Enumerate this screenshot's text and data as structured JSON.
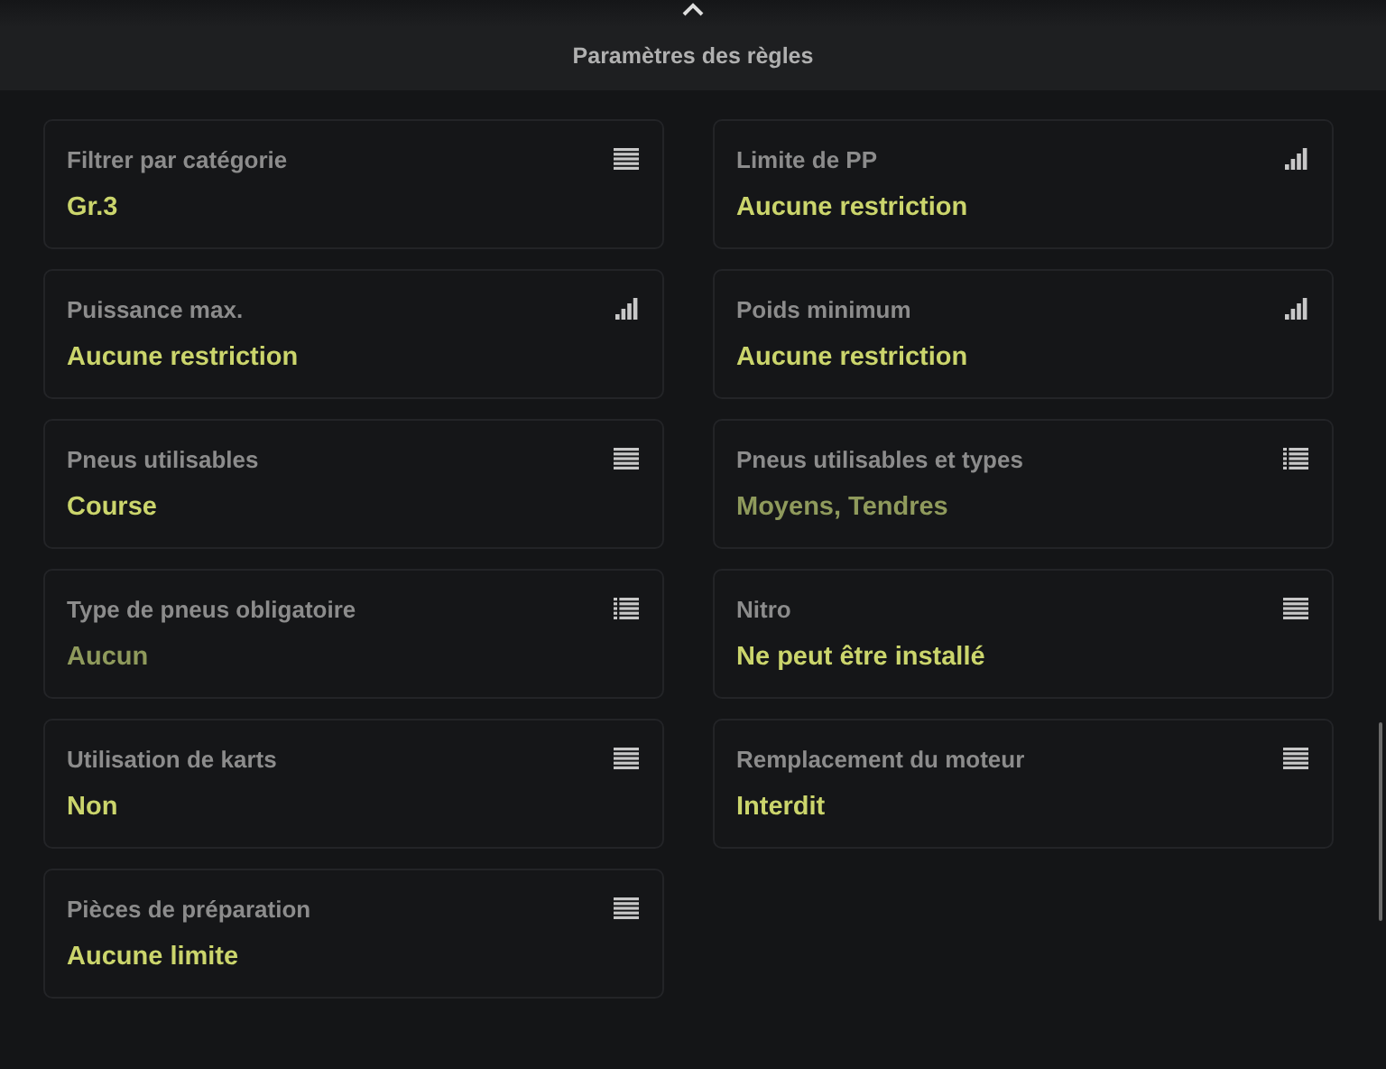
{
  "header": {
    "title": "Paramètres des règles"
  },
  "settings": [
    {
      "label": "Filtrer par catégorie",
      "value": "Gr.3",
      "kind": "options"
    },
    {
      "label": "Limite de PP",
      "value": "Aucune restriction",
      "kind": "level"
    },
    {
      "label": "Puissance max.",
      "value": "Aucune restriction",
      "kind": "level"
    },
    {
      "label": "Poids minimum",
      "value": "Aucune restriction",
      "kind": "level"
    },
    {
      "label": "Pneus utilisables",
      "value": "Course",
      "kind": "options"
    },
    {
      "label": "Pneus utilisables et types",
      "value": "Moyens, Tendres",
      "kind": "multi"
    },
    {
      "label": "Type de pneus obligatoire",
      "value": "Aucun",
      "kind": "multi"
    },
    {
      "label": "Nitro",
      "value": "Ne peut être installé",
      "kind": "options"
    },
    {
      "label": "Utilisation de karts",
      "value": "Non",
      "kind": "options"
    },
    {
      "label": "Remplacement du moteur",
      "value": "Interdit",
      "kind": "options"
    },
    {
      "label": "Pièces de préparation",
      "value": "Aucune limite",
      "kind": "options"
    }
  ]
}
